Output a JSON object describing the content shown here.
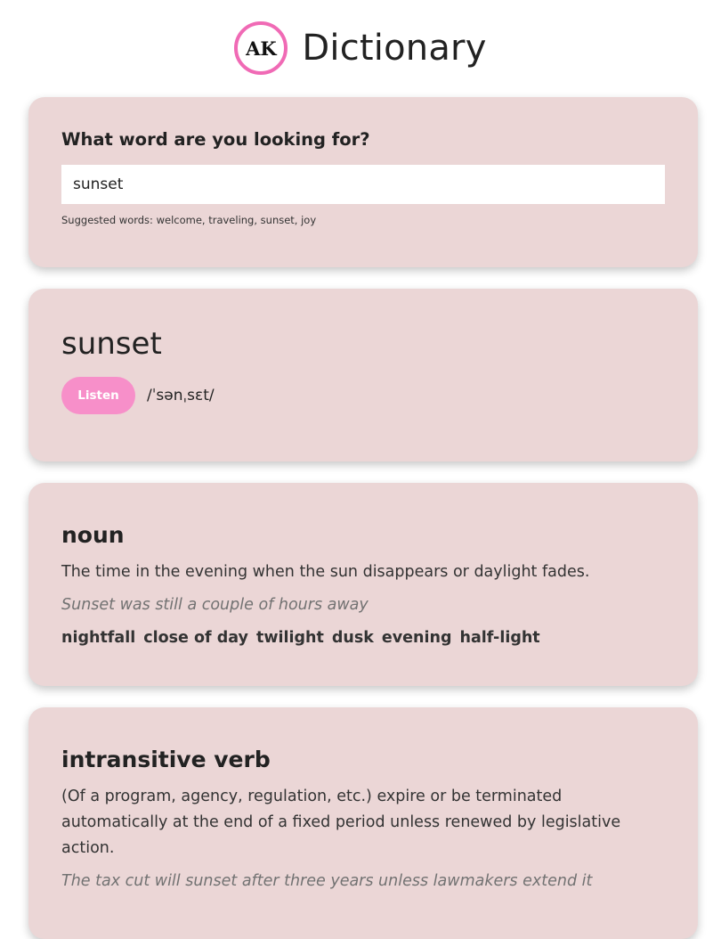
{
  "header": {
    "logo_text": "AK",
    "title": "Dictionary"
  },
  "search": {
    "heading": "What word are you looking for?",
    "value": "sunset",
    "hint": "Suggested words: welcome, traveling, sunset, joy"
  },
  "word": {
    "text": "sunset",
    "listen_label": "Listen",
    "phonetic": "/ˈsənˌsɛt/"
  },
  "meanings": [
    {
      "part_of_speech": "noun",
      "definition": "The time in the evening when the sun disappears or daylight fades.",
      "example": "Sunset was still a couple of hours away",
      "synonyms": [
        "nightfall",
        "close of day",
        "twilight",
        "dusk",
        "evening",
        "half-light"
      ]
    },
    {
      "part_of_speech": "intransitive verb",
      "definition": "(Of a program, agency, regulation, etc.) expire or be terminated automatically at the end of a fixed period unless renewed by legislative action.",
      "example": "The tax cut will sunset after three years unless lawmakers extend it"
    }
  ],
  "colors": {
    "card_background": "#ebd6d6",
    "accent_pink": "#f78fc9",
    "logo_ring": "#f06ab5"
  }
}
